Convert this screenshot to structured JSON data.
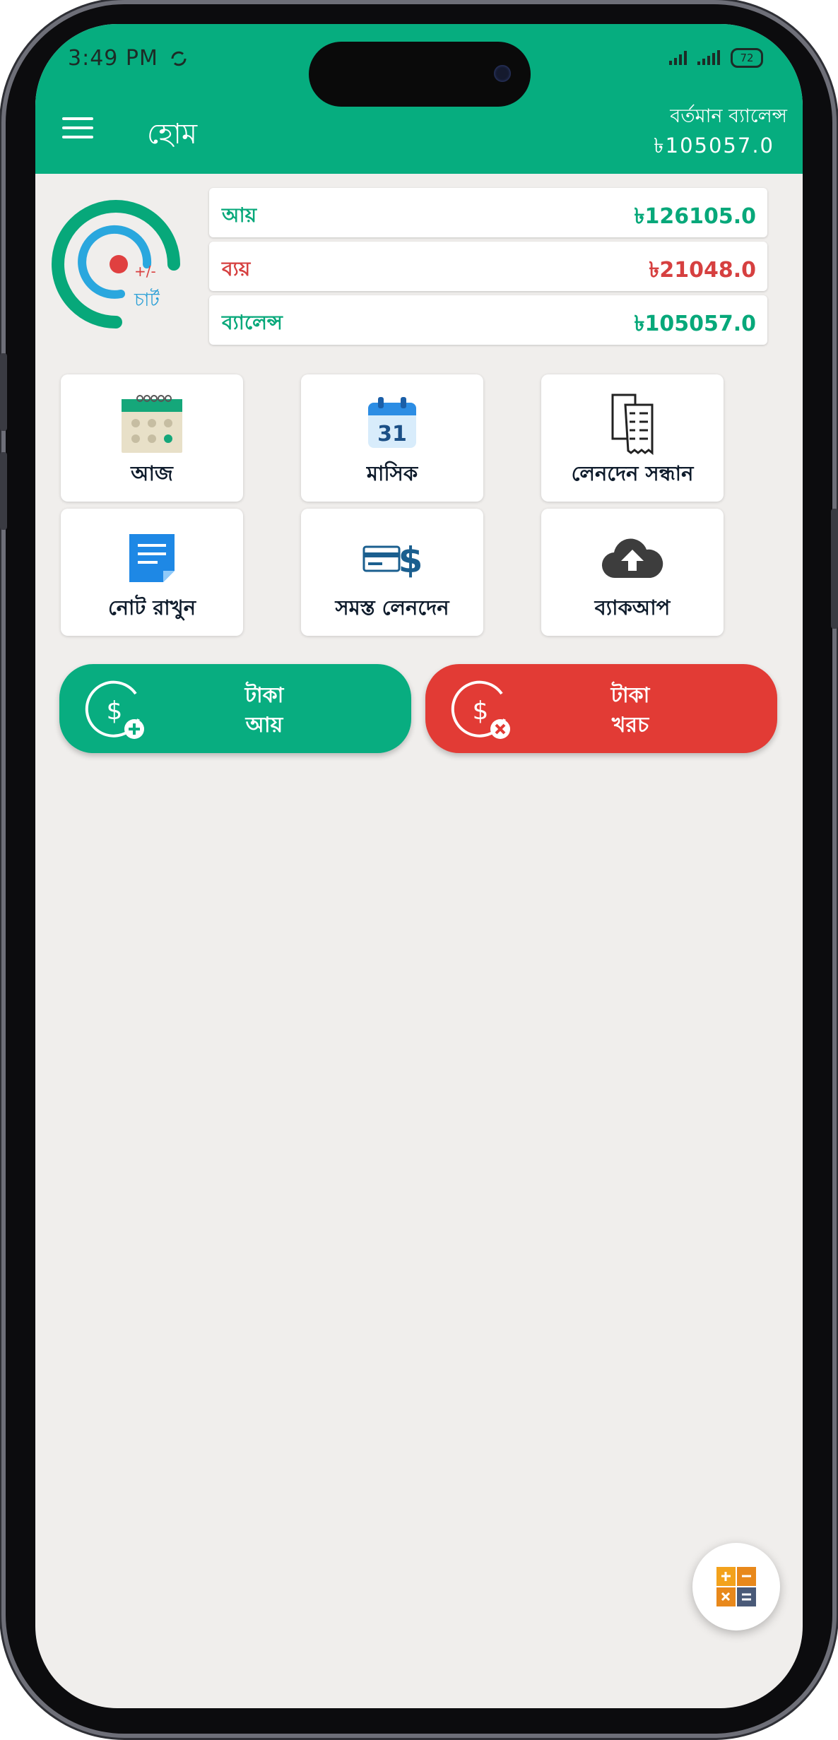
{
  "status_bar": {
    "time": "3:49 PM",
    "battery": "72"
  },
  "app_bar": {
    "title": "হোম",
    "balance_label": "বর্তমান ব্যালেন্স",
    "balance_value": "৳105057.0"
  },
  "gauge": {
    "symbol": "+/-",
    "label": "চার্ট"
  },
  "summary": [
    {
      "label": "আয়",
      "value": "৳126105.0",
      "color": "#07a87a"
    },
    {
      "label": "ব্যয়",
      "value": "৳21048.0",
      "color": "#d64040"
    },
    {
      "label": "ব্যালেন্স",
      "value": "৳105057.0",
      "color": "#07a87a"
    }
  ],
  "tiles": [
    {
      "label": "আজ",
      "icon": "calendar-dots-icon"
    },
    {
      "label": "মাসিক",
      "icon": "calendar-31-icon"
    },
    {
      "label": "লেনদেন সন্ধান",
      "icon": "receipt-search-icon"
    },
    {
      "label": "নোট রাখুন",
      "icon": "note-icon"
    },
    {
      "label": "সমস্ত লেনদেন",
      "icon": "card-dollar-icon"
    },
    {
      "label": "ব্যাকআপ",
      "icon": "cloud-upload-icon"
    }
  ],
  "calendar_day": "31",
  "actions": {
    "income": {
      "line1": "টাকা",
      "line2": "আয়",
      "color": "#08ad80"
    },
    "expense": {
      "line1": "টাকা",
      "line2": "খরচ",
      "color": "#e23b35"
    }
  },
  "fab": {
    "icon": "calculator-icon"
  }
}
